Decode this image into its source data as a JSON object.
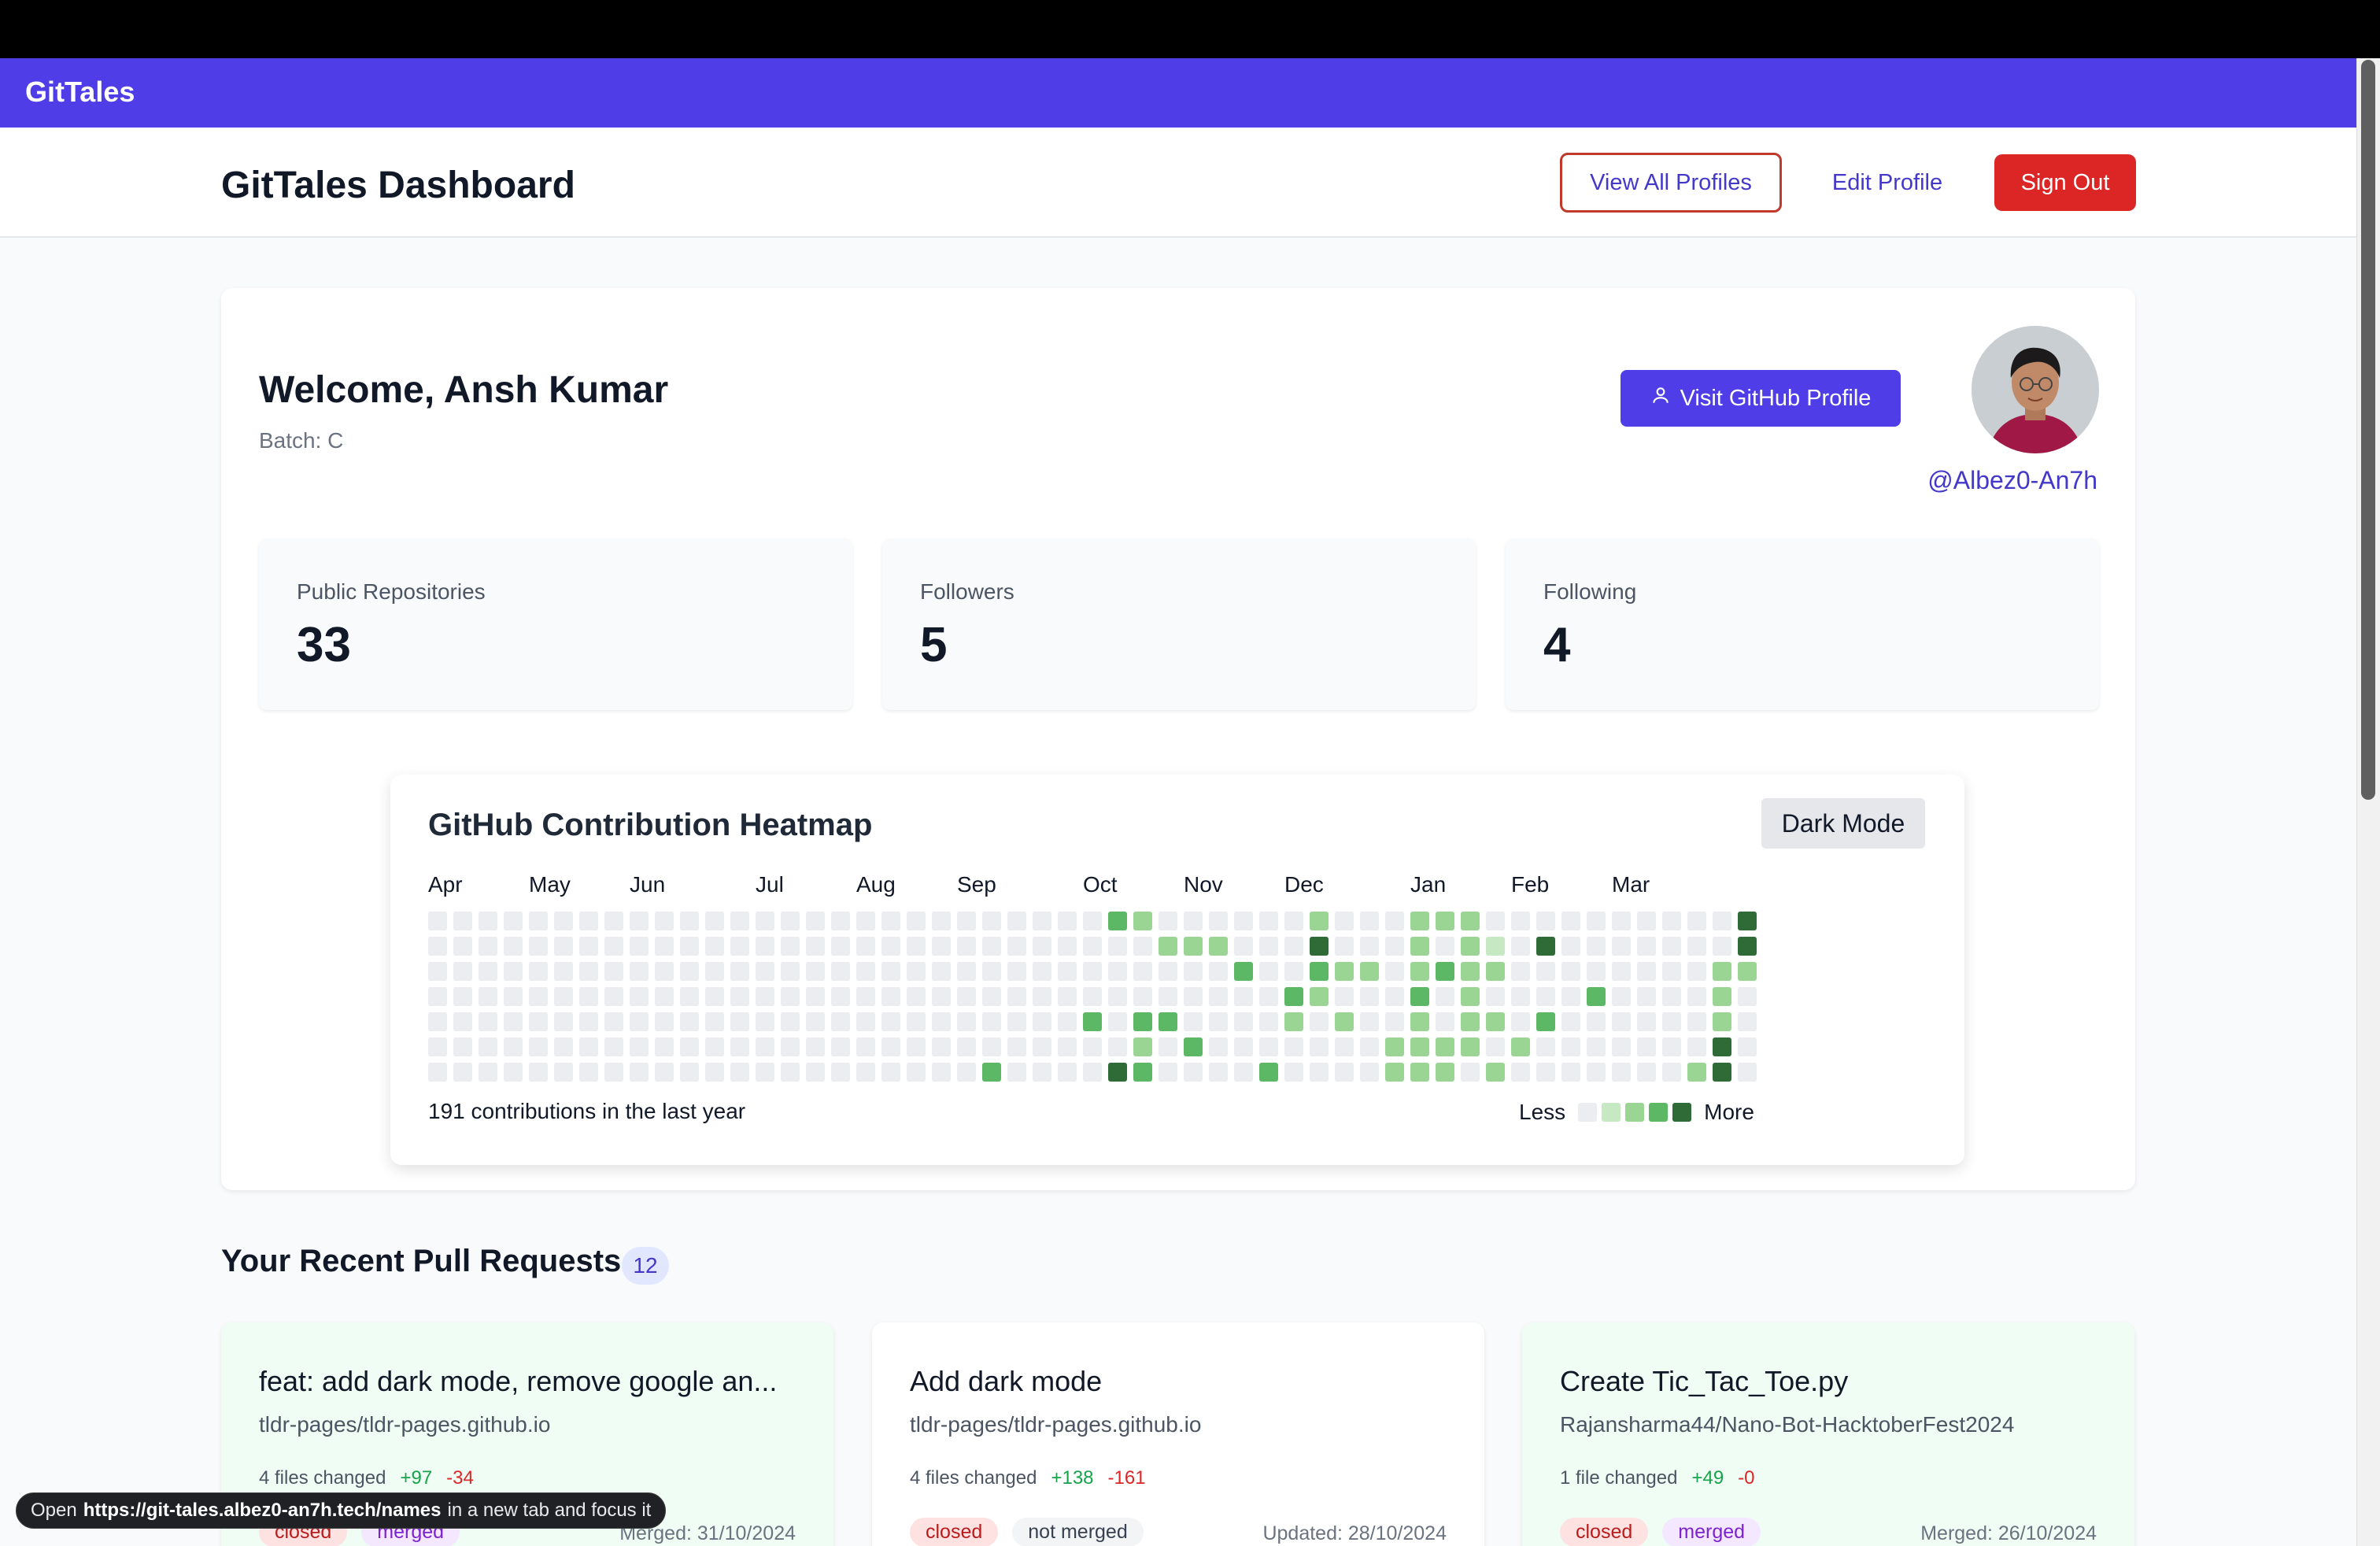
{
  "app": {
    "brand": "GitTales"
  },
  "header": {
    "title": "GitTales Dashboard",
    "view_all": "View All Profiles",
    "edit_profile": "Edit Profile",
    "sign_out": "Sign Out"
  },
  "profile": {
    "welcome": "Welcome, Ansh Kumar",
    "batch": "Batch: C",
    "visit_github": "Visit GitHub Profile",
    "handle": "@Albez0-An7h",
    "stats": [
      {
        "label": "Public Repositories",
        "value": "33"
      },
      {
        "label": "Followers",
        "value": "5"
      },
      {
        "label": "Following",
        "value": "4"
      }
    ]
  },
  "heatmap": {
    "title": "GitHub Contribution Heatmap",
    "dark_mode": "Dark Mode",
    "months": [
      "Apr",
      "May",
      "Jun",
      "Jul",
      "Aug",
      "Sep",
      "Oct",
      "Nov",
      "Dec",
      "Jan",
      "Feb",
      "Mar"
    ],
    "total": "191 contributions in the last year",
    "legend_less": "Less",
    "legend_more": "More",
    "colors": [
      "#ebedf0",
      "#c6e8c3",
      "#9ad594",
      "#5db865",
      "#2f6b37"
    ],
    "weeks": 53,
    "active": [
      [
        27,
        0,
        3
      ],
      [
        28,
        0,
        2
      ],
      [
        35,
        0,
        2
      ],
      [
        39,
        0,
        2
      ],
      [
        40,
        0,
        2
      ],
      [
        41,
        0,
        2
      ],
      [
        52,
        0,
        4
      ],
      [
        29,
        1,
        2
      ],
      [
        30,
        1,
        2
      ],
      [
        31,
        1,
        2
      ],
      [
        35,
        1,
        4
      ],
      [
        39,
        1,
        2
      ],
      [
        41,
        1,
        2
      ],
      [
        42,
        1,
        1
      ],
      [
        44,
        1,
        4
      ],
      [
        52,
        1,
        4
      ],
      [
        32,
        2,
        3
      ],
      [
        35,
        2,
        3
      ],
      [
        36,
        2,
        2
      ],
      [
        37,
        2,
        2
      ],
      [
        39,
        2,
        2
      ],
      [
        40,
        2,
        3
      ],
      [
        41,
        2,
        2
      ],
      [
        42,
        2,
        2
      ],
      [
        51,
        2,
        2
      ],
      [
        52,
        2,
        2
      ],
      [
        34,
        3,
        3
      ],
      [
        35,
        3,
        2
      ],
      [
        39,
        3,
        3
      ],
      [
        41,
        3,
        2
      ],
      [
        46,
        3,
        3
      ],
      [
        51,
        3,
        2
      ],
      [
        26,
        4,
        3
      ],
      [
        28,
        4,
        3
      ],
      [
        29,
        4,
        3
      ],
      [
        34,
        4,
        2
      ],
      [
        36,
        4,
        2
      ],
      [
        39,
        4,
        2
      ],
      [
        41,
        4,
        2
      ],
      [
        42,
        4,
        2
      ],
      [
        44,
        4,
        3
      ],
      [
        51,
        4,
        2
      ],
      [
        28,
        5,
        2
      ],
      [
        30,
        5,
        3
      ],
      [
        38,
        5,
        2
      ],
      [
        39,
        5,
        2
      ],
      [
        40,
        5,
        2
      ],
      [
        41,
        5,
        2
      ],
      [
        43,
        5,
        2
      ],
      [
        51,
        5,
        4
      ],
      [
        22,
        6,
        3
      ],
      [
        27,
        6,
        4
      ],
      [
        28,
        6,
        3
      ],
      [
        33,
        6,
        3
      ],
      [
        38,
        6,
        2
      ],
      [
        39,
        6,
        2
      ],
      [
        40,
        6,
        2
      ],
      [
        42,
        6,
        2
      ],
      [
        50,
        6,
        2
      ],
      [
        51,
        6,
        4
      ]
    ]
  },
  "pull_requests": {
    "title": "Your Recent Pull Requests",
    "count": "12",
    "items": [
      {
        "title": "feat: add dark mode, remove google an...",
        "repo": "tldr-pages/tldr-pages.github.io",
        "files": "4 files changed",
        "additions": "+97",
        "deletions": "-34",
        "tags": [
          "closed",
          "merged"
        ],
        "date": "Merged: 31/10/2024",
        "bg": "#f0fdf4"
      },
      {
        "title": "Add dark mode",
        "repo": "tldr-pages/tldr-pages.github.io",
        "files": "4 files changed",
        "additions": "+138",
        "deletions": "-161",
        "tags": [
          "closed",
          "not merged"
        ],
        "date": "Updated: 28/10/2024",
        "bg": "#ffffff"
      },
      {
        "title": "Create Tic_Tac_Toe.py",
        "repo": "Rajansharma44/Nano-Bot-HacktoberFest2024",
        "files": "1 file changed",
        "additions": "+49",
        "deletions": "-0",
        "tags": [
          "closed",
          "merged"
        ],
        "date": "Merged: 26/10/2024",
        "bg": "#f0fdf4"
      }
    ]
  },
  "status_bar": {
    "prefix": "Open",
    "url": "https://git-tales.albez0-an7h.tech/names",
    "suffix": "in a new tab and focus it"
  }
}
